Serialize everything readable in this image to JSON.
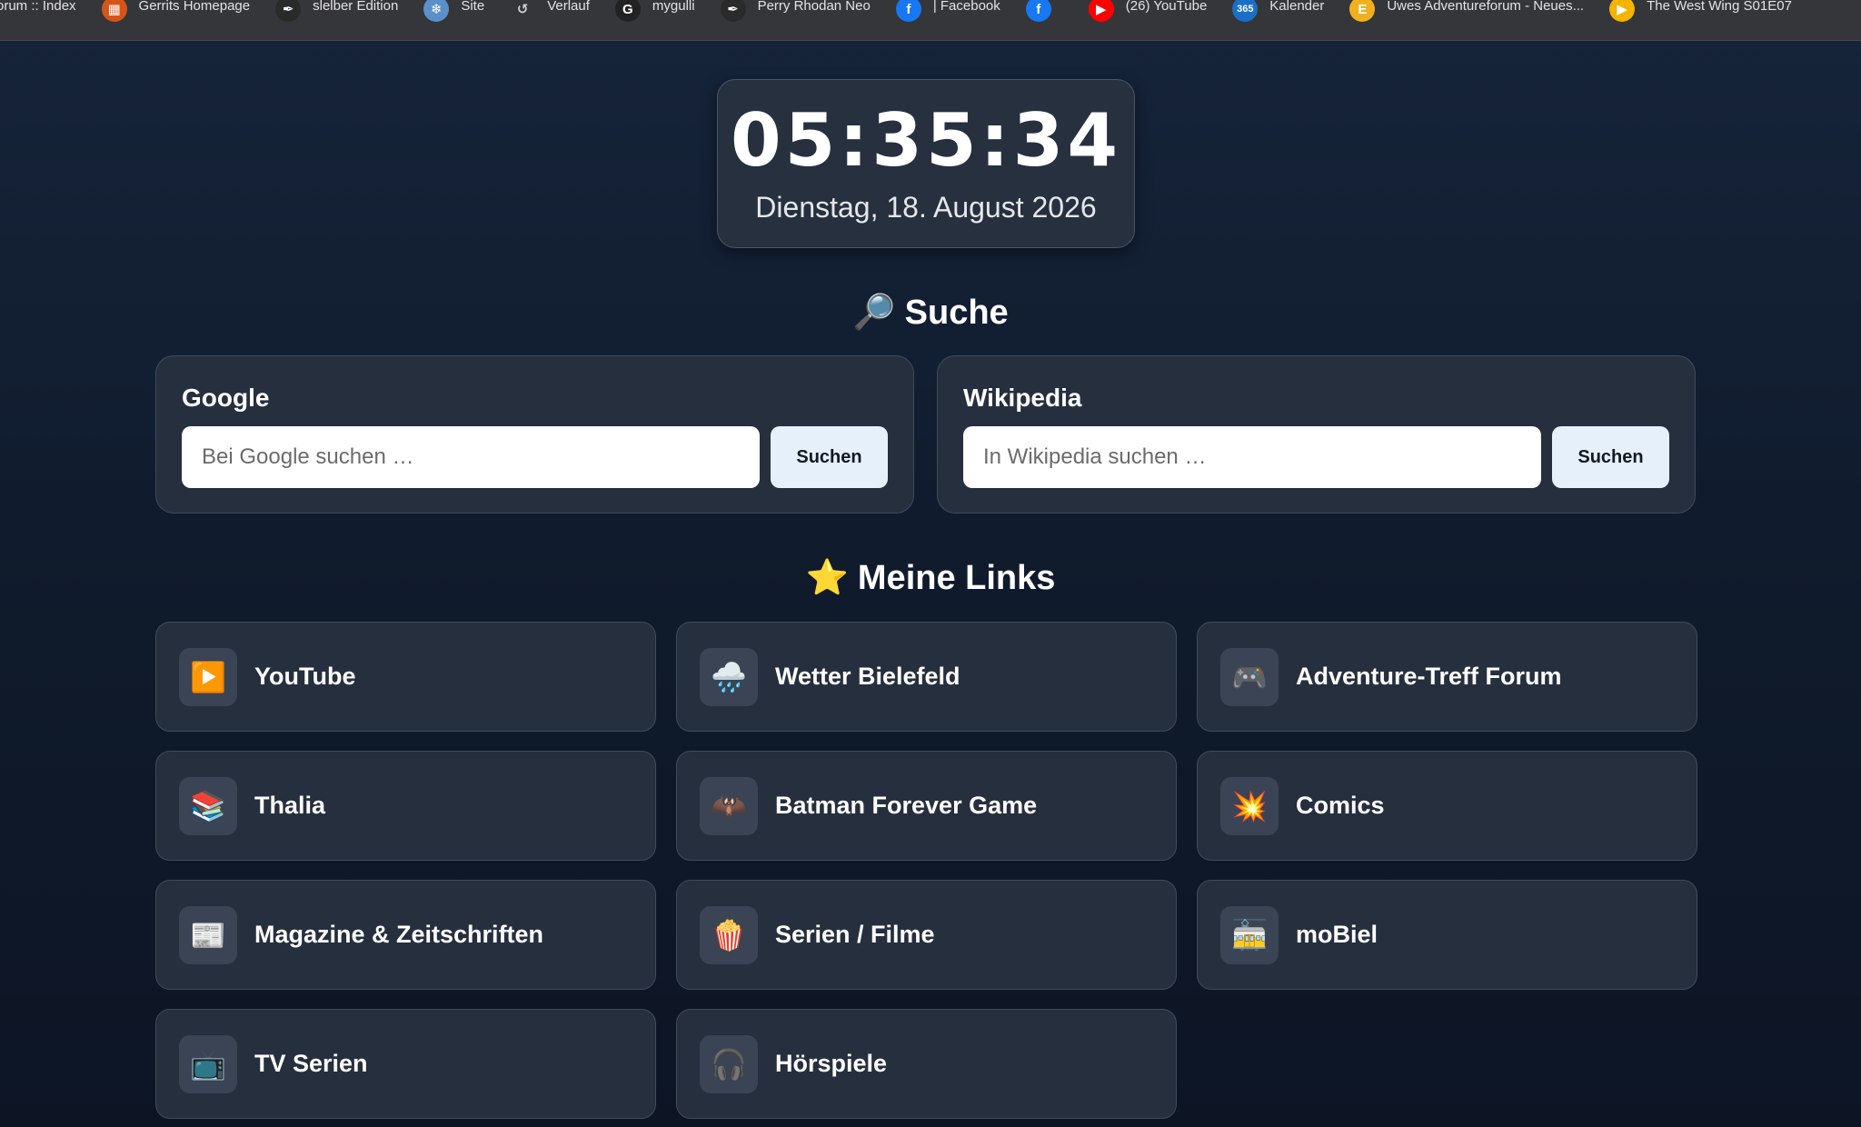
{
  "bookmarks": [
    {
      "label": "orum :: Index",
      "icon": "",
      "color": "transparent"
    },
    {
      "label": "Gerrits Homepage",
      "icon": "▦",
      "color": "#d4551a"
    },
    {
      "label": "slelber Edition",
      "icon": "✒",
      "color": "#2a2a2a"
    },
    {
      "label": "Site",
      "icon": "❄",
      "color": "#5b8fc9"
    },
    {
      "label": "Verlauf",
      "icon": "↺",
      "color": "transparent"
    },
    {
      "label": "mygulli",
      "icon": "G",
      "color": "#222222"
    },
    {
      "label": "Perry Rhodan Neo",
      "icon": "✒",
      "color": "#2a2a2a"
    },
    {
      "label": "| Facebook",
      "icon": "f",
      "color": "#1877f2"
    },
    {
      "label": "",
      "icon": "f",
      "color": "#1877f2"
    },
    {
      "label": "(26) YouTube",
      "icon": "▶",
      "color": "#ff0000"
    },
    {
      "label": "Kalender",
      "icon": "365",
      "color": "#1a6fc9"
    },
    {
      "label": "Uwes Adventureforum - Neues...",
      "icon": "E",
      "color": "#f0b020"
    },
    {
      "label": "The West Wing S01E07",
      "icon": "▶",
      "color": "#f5b400"
    }
  ],
  "clock": {
    "time": "05:35:34",
    "date": "Dienstag, 18. August 2026"
  },
  "search": {
    "heading_emoji": "🔎",
    "heading": "Suche",
    "google": {
      "label": "Google",
      "placeholder": "Bei Google suchen …",
      "button": "Suchen"
    },
    "wikipedia": {
      "label": "Wikipedia",
      "placeholder": "In Wikipedia suchen …",
      "button": "Suchen"
    }
  },
  "links": {
    "heading_emoji": "⭐",
    "heading": "Meine Links",
    "items": [
      {
        "label": "YouTube",
        "icon": "▶️",
        "icon_name": "play-icon"
      },
      {
        "label": "Wetter Bielefeld",
        "icon": "🌧️",
        "icon_name": "weather-icon"
      },
      {
        "label": "Adventure-Treff Forum",
        "icon": "🎮",
        "icon_name": "gamepad-icon"
      },
      {
        "label": "Thalia",
        "icon": "📚",
        "icon_name": "books-icon"
      },
      {
        "label": "Batman Forever Game",
        "icon": "🦇",
        "icon_name": "bat-icon"
      },
      {
        "label": "Comics",
        "icon": "💥",
        "icon_name": "explosion-icon"
      },
      {
        "label": "Magazine & Zeitschriften",
        "icon": "📰",
        "icon_name": "newspaper-icon"
      },
      {
        "label": "Serien / Filme",
        "icon": "🍿",
        "icon_name": "popcorn-icon"
      },
      {
        "label": "moBiel",
        "icon": "🚋",
        "icon_name": "tram-icon"
      },
      {
        "label": "TV Serien",
        "icon": "📺",
        "icon_name": "tv-icon"
      },
      {
        "label": "Hörspiele",
        "icon": "🎧",
        "icon_name": "headphones-icon"
      }
    ]
  }
}
